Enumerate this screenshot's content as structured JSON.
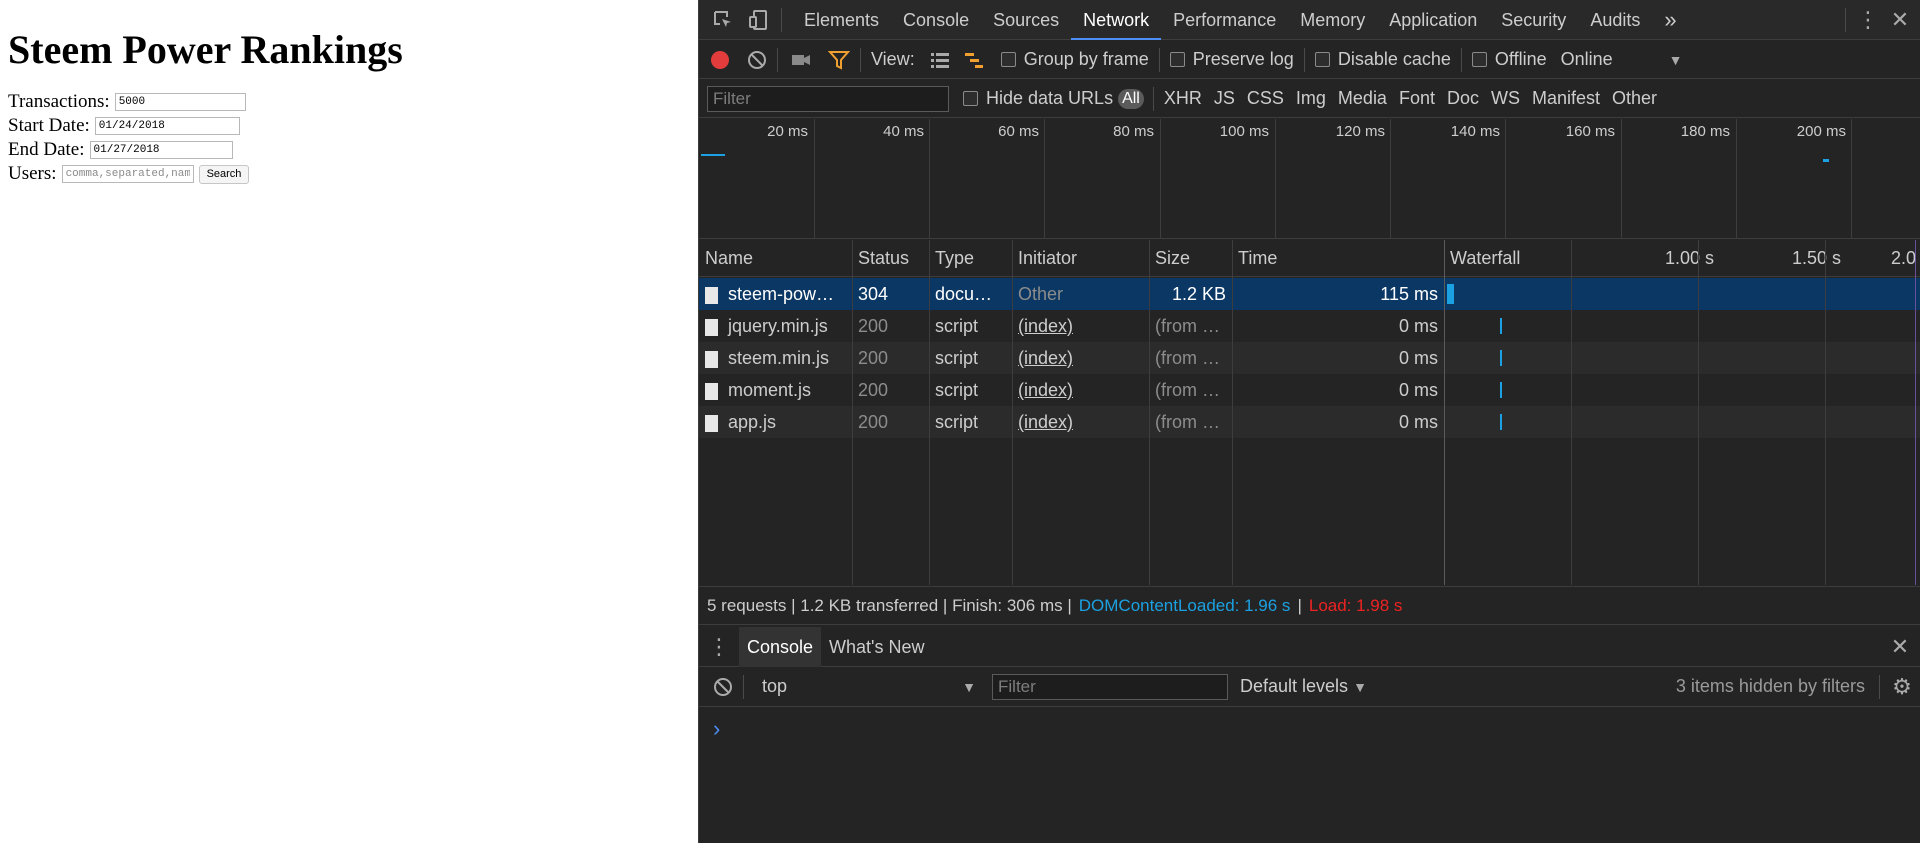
{
  "page": {
    "title": "Steem Power Rankings",
    "transactions": {
      "label": "Transactions:",
      "value": "5000"
    },
    "start_date": {
      "label": "Start Date:",
      "value": "01/24/2018"
    },
    "end_date": {
      "label": "End Date:",
      "value": "01/27/2018"
    },
    "users": {
      "label": "Users:",
      "placeholder": "comma,separated,names"
    },
    "search_label": "Search"
  },
  "devtools": {
    "tabs": [
      "Elements",
      "Console",
      "Sources",
      "Network",
      "Performance",
      "Memory",
      "Application",
      "Security",
      "Audits"
    ],
    "more_tabs": "»",
    "active_tab": "Network",
    "network": {
      "view_label": "View:",
      "group_by_frame": "Group by frame",
      "preserve_log": "Preserve log",
      "disable_cache": "Disable cache",
      "offline": "Offline",
      "throttling": "Online",
      "filter_placeholder": "Filter",
      "hide_data_urls": "Hide data URLs",
      "types": [
        "All",
        "XHR",
        "JS",
        "CSS",
        "Img",
        "Media",
        "Font",
        "Doc",
        "WS",
        "Manifest",
        "Other"
      ],
      "overview_ticks": [
        "20 ms",
        "40 ms",
        "60 ms",
        "80 ms",
        "100 ms",
        "120 ms",
        "140 ms",
        "160 ms",
        "180 ms",
        "200 ms"
      ],
      "columns": {
        "name": "Name",
        "status": "Status",
        "type": "Type",
        "initiator": "Initiator",
        "size": "Size",
        "time": "Time",
        "waterfall": "Waterfall"
      },
      "waterfall_ticks": [
        "1.00 s",
        "1.50 s",
        "2.0"
      ],
      "rows": [
        {
          "name": "steem-pow…",
          "status": "304",
          "type": "docu…",
          "initiator": "Other",
          "size": "1.2 KB",
          "time": "115 ms"
        },
        {
          "name": "jquery.min.js",
          "status": "200",
          "type": "script",
          "initiator": "(index)",
          "size": "(from …",
          "time": "0 ms"
        },
        {
          "name": "steem.min.js",
          "status": "200",
          "type": "script",
          "initiator": "(index)",
          "size": "(from …",
          "time": "0 ms"
        },
        {
          "name": "moment.js",
          "status": "200",
          "type": "script",
          "initiator": "(index)",
          "size": "(from …",
          "time": "0 ms"
        },
        {
          "name": "app.js",
          "status": "200",
          "type": "script",
          "initiator": "(index)",
          "size": "(from …",
          "time": "0 ms"
        }
      ],
      "summary": {
        "main": "5 requests | 1.2 KB transferred | Finish: 306 ms |",
        "dom": "DOMContentLoaded: 1.96 s",
        "divider": "|",
        "load": "Load: 1.98 s"
      }
    },
    "drawer": {
      "tabs": [
        "Console",
        "What's New"
      ],
      "context": "top",
      "filter_placeholder": "Filter",
      "levels": "Default levels",
      "hidden_note": "3 items hidden by filters",
      "prompt": "›"
    },
    "colors": {
      "accent": "#4d8ef7",
      "selected_row": "#0a3764",
      "bar": "#1ba1e2",
      "load": "#ee2222"
    }
  }
}
